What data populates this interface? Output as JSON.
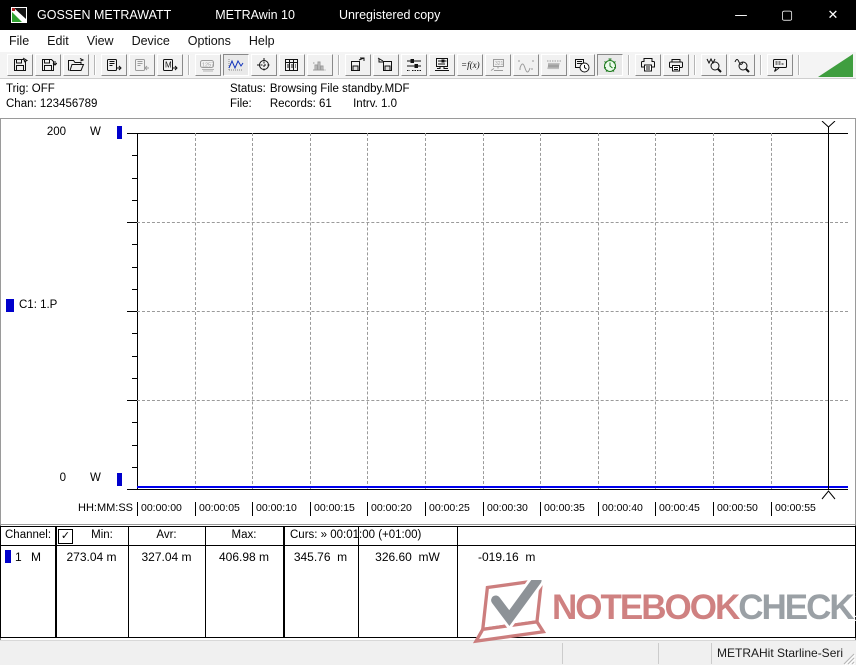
{
  "titlebar": {
    "brand": "GOSSEN METRAWATT",
    "app": "METRAwin 10",
    "license": "Unregistered copy",
    "minimize": "—",
    "maximize": "▢",
    "close": "✕"
  },
  "menubar": {
    "items": [
      "File",
      "Edit",
      "View",
      "Device",
      "Options",
      "Help"
    ]
  },
  "toolbar": {
    "buttons": [
      {
        "name": "save-file"
      },
      {
        "name": "save-file-as"
      },
      {
        "name": "open-file"
      },
      {
        "name": "read-device-memory"
      },
      {
        "name": "read-device-memory-alt",
        "disabled": true
      },
      {
        "name": "device-memory-m"
      },
      {
        "name": "numeric-display",
        "disabled": true
      },
      {
        "name": "yt-chart-view",
        "pressed": true
      },
      {
        "name": "cursor-crosshair-view"
      },
      {
        "name": "data-table-view"
      },
      {
        "name": "histogram-view",
        "disabled": true
      },
      {
        "name": "export-to-device"
      },
      {
        "name": "import-from-device"
      },
      {
        "name": "channel-settings"
      },
      {
        "name": "monitor-settings"
      },
      {
        "name": "formula-fx"
      },
      {
        "name": "pc-transfer",
        "disabled": true
      },
      {
        "name": "analog-wave",
        "disabled": true
      },
      {
        "name": "ripple-wave",
        "disabled": true
      },
      {
        "name": "interval-clock"
      },
      {
        "name": "timer-recording-active",
        "pressed": true
      },
      {
        "name": "print-preview"
      },
      {
        "name": "print"
      },
      {
        "name": "zoom-time-axis"
      },
      {
        "name": "zoom-value-axis"
      },
      {
        "name": "comment-note"
      }
    ]
  },
  "infobar": {
    "trig": "Trig: OFF",
    "chan": "Chan: 123456789",
    "status_label": "Status:",
    "status_value": "Browsing File standby.MDF",
    "file_label": "File:",
    "records": "Records: 61",
    "interval": "Intrv. 1.0"
  },
  "chart": {
    "y_max": "200",
    "y_max_unit": "W",
    "y_min": "0",
    "y_min_unit": "W",
    "channel_label": "C1: 1.P",
    "x_axis_label": "HH:MM:SS",
    "x_labels": [
      "00:00:00",
      "00:00:05",
      "00:00:10",
      "00:00:15",
      "00:00:20",
      "00:00:25",
      "00:00:30",
      "00:00:35",
      "00:00:40",
      "00:00:45",
      "00:00:50",
      "00:00:55"
    ]
  },
  "chart_data": {
    "type": "line",
    "title": "Channel C1 power while browsing file standby.MDF",
    "xlabel": "HH:MM:SS",
    "ylabel": "W",
    "ylim": [
      0,
      200
    ],
    "x_tick_interval_s": 5,
    "grid": true,
    "series": [
      {
        "name": "C1: 1.P",
        "unit": "W",
        "x_s": [
          0,
          5,
          10,
          15,
          20,
          25,
          30,
          35,
          40,
          45,
          50,
          55,
          60
        ],
        "y_w": [
          0.33,
          0.33,
          0.33,
          0.33,
          0.33,
          0.33,
          0.33,
          0.33,
          0.33,
          0.33,
          0.33,
          0.33,
          0.33
        ],
        "min_w": 0.27304,
        "avr_w": 0.32704,
        "max_w": 0.40698
      }
    ],
    "cursor": {
      "time": "00:01:00",
      "offset": "+01:00",
      "x_s": 60,
      "values": [
        "345.76 m",
        "326.60 mW",
        "-019.16 m"
      ]
    },
    "legend_position": "left"
  },
  "channel_table": {
    "header": {
      "channel": "Channel:",
      "checkbox": "✓",
      "min": "Min:",
      "avr": "Avr:",
      "max": "Max:",
      "cursor": "Curs: » 00:01:00 (+01:00)"
    },
    "row": {
      "channel": "1",
      "mode": "M",
      "min": "273.04 m",
      "avr": "327.04 m",
      "max": "406.98 m",
      "cursor_a": "345.76  m",
      "cursor_b": "326.60  mW",
      "cursor_diff": "-019.16  m"
    }
  },
  "watermark": {
    "part1": "NOTEBOOK",
    "part2": "CHECK"
  },
  "statusbar": {
    "device": "METRAHit Starline-Seri"
  },
  "colors": {
    "marker_blue": "#0000cc",
    "trace_blue": "#0000ee",
    "grid_gray": "#9a9a9a",
    "watermark_red": "#cf8181",
    "watermark_gray": "#9aa0a5",
    "toolbar_green": "#3f9e3f",
    "titlebar_bg": "#000000"
  }
}
